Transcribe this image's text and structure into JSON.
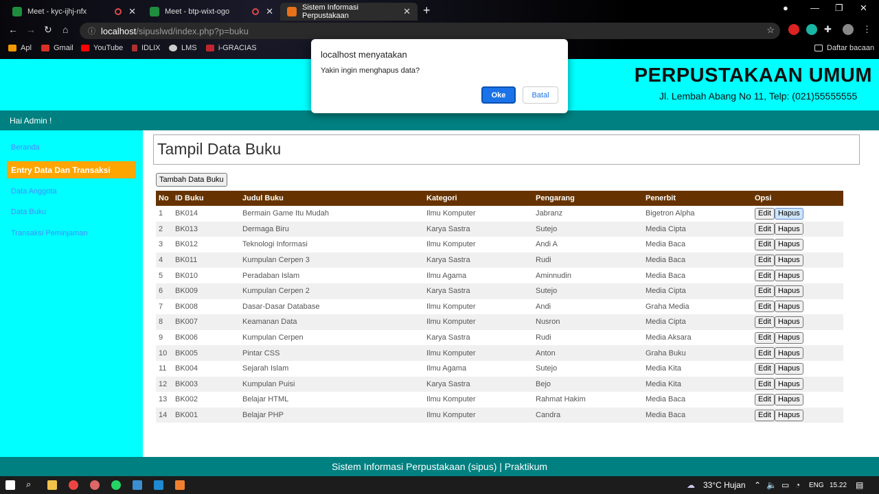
{
  "browser": {
    "tabs": [
      {
        "title": "Meet - kyc-ijhj-nfx",
        "recording": true
      },
      {
        "title": "Meet - btp-wixt-ogo",
        "recording": true
      },
      {
        "title": "Sistem Informasi Perpustakaan",
        "active": true
      }
    ],
    "address": {
      "host": "localhost",
      "path": "/sipuslwd/index.php?p=buku"
    },
    "bookmarks": [
      "Apl",
      "Gmail",
      "YouTube",
      "IDLIX",
      "LMS",
      "i-GRACIAS"
    ],
    "reading_list": "Daftar bacaan"
  },
  "site": {
    "title": "PERPUSTAKAAN UMUM",
    "address": "Jl. Lembah Abang No 11, Telp: (021)55555555",
    "greeting": "Hai Admin !",
    "footer": "Sistem Informasi Perpustakaan (sipus) | Praktikum"
  },
  "sidebar": {
    "items": [
      {
        "label": "Beranda"
      },
      {
        "label": "Entry Data Dan Transaksi",
        "active": true
      },
      {
        "label": "Data Anggota"
      },
      {
        "label": "Data Buku"
      },
      {
        "label": "Transaksi Peminjaman"
      }
    ]
  },
  "main": {
    "title": "Tampil Data Buku",
    "add_button": "Tambah Data Buku",
    "columns": [
      "No",
      "ID Buku",
      "Judul Buku",
      "Kategori",
      "Pengarang",
      "Penerbit",
      "Opsi"
    ],
    "edit_label": "Edit",
    "delete_label": "Hapus",
    "rows": [
      [
        "1",
        "BK014",
        "Bermain Game Itu Mudah",
        "Ilmu Komputer",
        "Jabranz",
        "Bigetron Alpha"
      ],
      [
        "2",
        "BK013",
        "Dermaga Biru",
        "Karya Sastra",
        "Sutejo",
        "Media Cipta"
      ],
      [
        "3",
        "BK012",
        "Teknologi Informasi",
        "Ilmu Komputer",
        "Andi A",
        "Media Baca"
      ],
      [
        "4",
        "BK011",
        "Kumpulan Cerpen 3",
        "Karya Sastra",
        "Rudi",
        "Media Baca"
      ],
      [
        "5",
        "BK010",
        "Peradaban Islam",
        "Ilmu Agama",
        "Aminnudin",
        "Media Baca"
      ],
      [
        "6",
        "BK009",
        "Kumpulan Cerpen 2",
        "Karya Sastra",
        "Sutejo",
        "Media Cipta"
      ],
      [
        "7",
        "BK008",
        "Dasar-Dasar Database",
        "Ilmu Komputer",
        "Andi",
        "Graha Media"
      ],
      [
        "8",
        "BK007",
        "Keamanan Data",
        "Ilmu Komputer",
        "Nusron",
        "Media Cipta"
      ],
      [
        "9",
        "BK006",
        "Kumpulan Cerpen",
        "Karya Sastra",
        "Rudi",
        "Media Aksara"
      ],
      [
        "10",
        "BK005",
        "Pintar CSS",
        "Ilmu Komputer",
        "Anton",
        "Graha Buku"
      ],
      [
        "11",
        "BK004",
        "Sejarah Islam",
        "Ilmu Agama",
        "Sutejo",
        "Media Kita"
      ],
      [
        "12",
        "BK003",
        "Kumpulan Puisi",
        "Karya Sastra",
        "Bejo",
        "Media Kita"
      ],
      [
        "13",
        "BK002",
        "Belajar HTML",
        "Ilmu Komputer",
        "Rahmat Hakim",
        "Media Baca"
      ],
      [
        "14",
        "BK001",
        "Belajar PHP",
        "Ilmu Komputer",
        "Candra",
        "Media Baca"
      ]
    ]
  },
  "dialog": {
    "title": "localhost menyatakan",
    "message": "Yakin ingin menghapus data?",
    "ok_label": "Oke",
    "cancel_label": "Batal"
  },
  "taskbar": {
    "weather": "33°C  Hujan",
    "language": "ENG",
    "time": "15.22"
  },
  "colors": {
    "page_bg": "#00ffff",
    "bar": "#008080",
    "table_header": "#663300",
    "active_menu": "#ffa500",
    "link": "#4a8aff"
  }
}
